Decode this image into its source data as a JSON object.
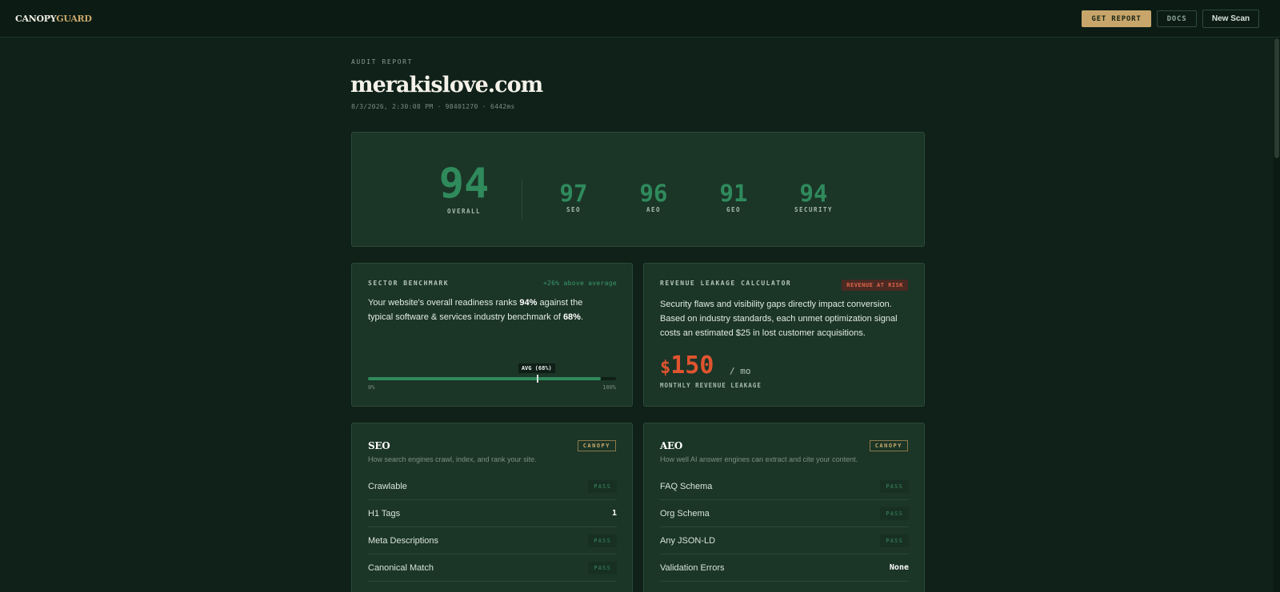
{
  "header": {
    "logo_part1": "CANOPY",
    "logo_part2": "GUARD",
    "get_report": "GET REPORT",
    "docs": "DOCS",
    "new_scan": "New Scan"
  },
  "report": {
    "eyebrow": "AUDIT REPORT",
    "domain": "merakislove.com",
    "meta": "8/3/2026, 2:30:08 PM · 98401270 · 6442ms"
  },
  "scores": {
    "overall": {
      "value": "94",
      "label": "OVERALL"
    },
    "items": [
      {
        "value": "97",
        "label": "SEO"
      },
      {
        "value": "96",
        "label": "AEO"
      },
      {
        "value": "91",
        "label": "GEO"
      },
      {
        "value": "94",
        "label": "SECURITY"
      }
    ]
  },
  "benchmark": {
    "title": "SECTOR BENCHMARK",
    "tag": "+26% above average",
    "text_before": "Your website's overall readiness ranks ",
    "rank": "94%",
    "text_middle": " against the typical software & services industry benchmark of ",
    "bench": "68%",
    "text_after": ".",
    "avg_label": "AVG (68%)",
    "bar_min": "0%",
    "bar_max": "100%",
    "score_fraction": 0.94,
    "avg_fraction": 0.68
  },
  "revenue": {
    "title": "REVENUE LEAKAGE CALCULATOR",
    "risk": "REVENUE AT RISK",
    "text": "Security flaws and visibility gaps directly impact conversion. Based on industry standards, each unmet optimization signal costs an estimated $25 in lost customer acquisitions.",
    "currency": "$",
    "amount": "150",
    "unit": "/ mo",
    "label": "MONTHLY REVENUE LEAKAGE"
  },
  "seo": {
    "title": "SEO",
    "badge": "CANOPY",
    "subtitle": "How search engines crawl, index, and rank your site.",
    "rows": [
      {
        "label": "Crawlable",
        "status": "PASS"
      },
      {
        "label": "H1 Tags",
        "status": "1"
      },
      {
        "label": "Meta Descriptions",
        "status": "PASS"
      },
      {
        "label": "Canonical Match",
        "status": "PASS"
      }
    ]
  },
  "aeo": {
    "title": "AEO",
    "badge": "CANOPY",
    "subtitle": "How well AI answer engines can extract and cite your content.",
    "rows": [
      {
        "label": "FAQ Schema",
        "status": "PASS"
      },
      {
        "label": "Org Schema",
        "status": "PASS"
      },
      {
        "label": "Any JSON-LD",
        "status": "PASS"
      },
      {
        "label": "Validation Errors",
        "status": "None"
      }
    ]
  }
}
